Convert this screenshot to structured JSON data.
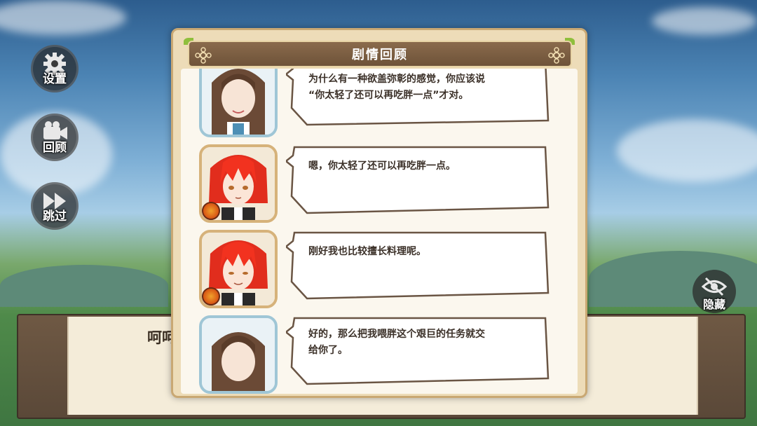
{
  "sidebar": {
    "settings_label": "设置",
    "review_label": "回顾",
    "skip_label": "跳过"
  },
  "hide_button": {
    "label": "隐藏"
  },
  "dialog": {
    "text": "呵呵"
  },
  "modal": {
    "title": "剧情回顾",
    "entries": [
      {
        "speaker": "brown-haired-girl",
        "line1": "为什么有一种欲盖弥彰的感觉，你应该说",
        "line2": "“你太轻了还可以再吃胖一点”才对。"
      },
      {
        "speaker": "red-haired-boy",
        "line1": "嗯，你太轻了还可以再吃胖一点。",
        "line2": ""
      },
      {
        "speaker": "red-haired-boy",
        "line1": "刚好我也比较擅长料理呢。",
        "line2": ""
      },
      {
        "speaker": "brown-haired-girl",
        "line1": "好的，那么把我喂胖这个艰巨的任务就交",
        "line2": "给你了。"
      }
    ]
  },
  "colors": {
    "banner": "#7a5c40",
    "panel": "#fbf7ee",
    "frame": "#c9a873"
  }
}
